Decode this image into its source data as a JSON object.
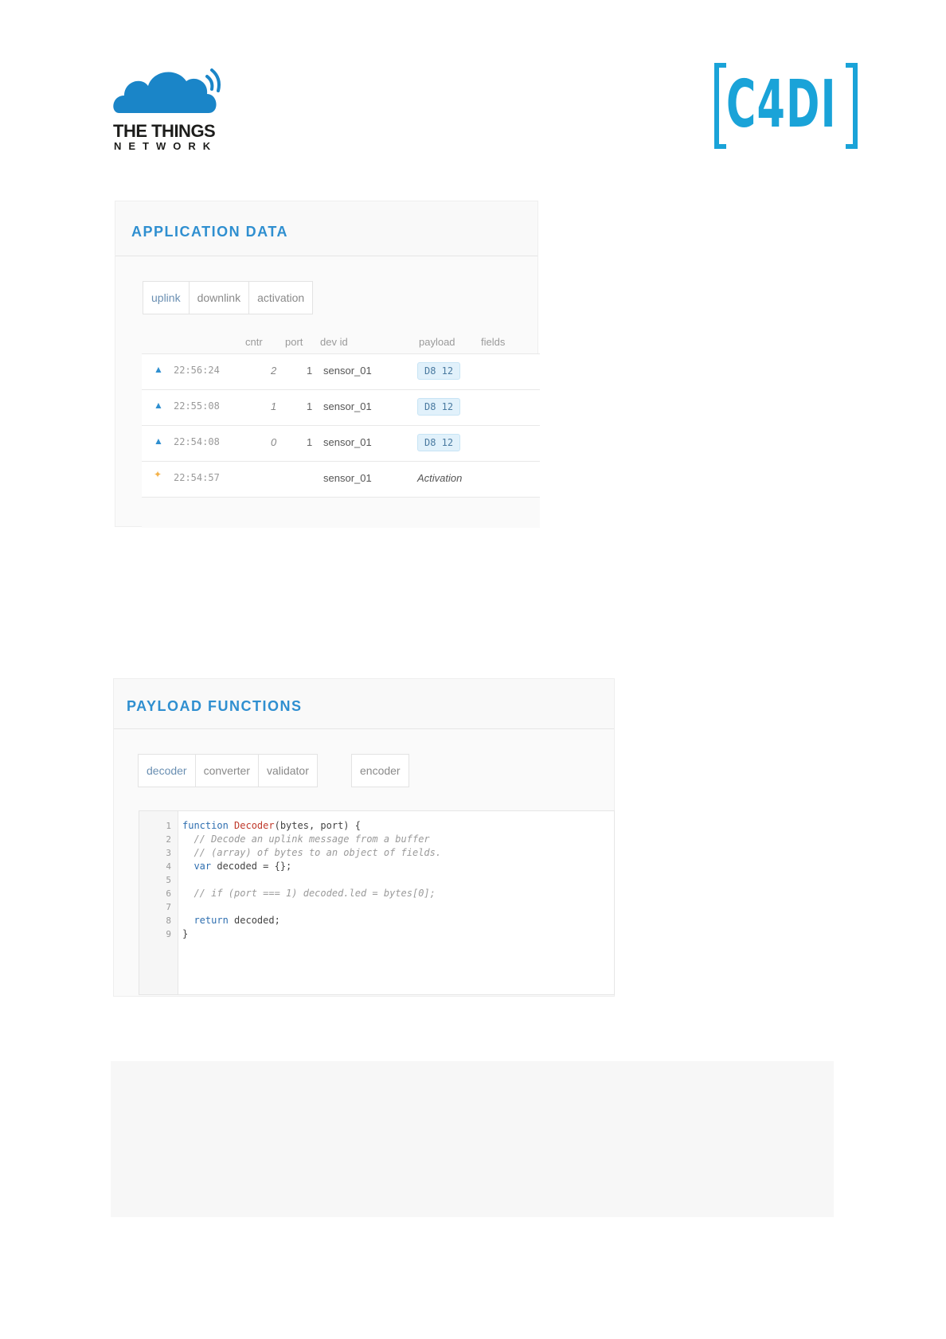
{
  "logos": {
    "ttn_title": "THE THINGS",
    "ttn_subtitle": "NETWORK",
    "c4di": "C4DI"
  },
  "colors": {
    "accent": "#2f8fd0",
    "c4di_blue": "#1aa3d8",
    "activation": "#f4b24a",
    "badge_bg": "#e1f1fb"
  },
  "application_data": {
    "title": "APPLICATION DATA",
    "tabs": [
      "uplink",
      "downlink",
      "activation"
    ],
    "columns": {
      "cntr": "cntr",
      "port": "port",
      "devid": "dev id",
      "payload": "payload",
      "fields": "fields"
    },
    "rows": [
      {
        "icon": "uplink-arrow-icon",
        "time": "22:56:24",
        "cntr": "2",
        "port": "1",
        "devid": "sensor_01",
        "payload": "D8 12"
      },
      {
        "icon": "uplink-arrow-icon",
        "time": "22:55:08",
        "cntr": "1",
        "port": "1",
        "devid": "sensor_01",
        "payload": "D8 12"
      },
      {
        "icon": "uplink-arrow-icon",
        "time": "22:54:08",
        "cntr": "0",
        "port": "1",
        "devid": "sensor_01",
        "payload": "D8 12"
      },
      {
        "icon": "activation-bolt-icon",
        "time": "22:54:57",
        "cntr": "",
        "port": "",
        "devid": "sensor_01",
        "payload": "Activation"
      }
    ]
  },
  "payload_functions": {
    "title": "PAYLOAD FUNCTIONS",
    "tabs": [
      "decoder",
      "converter",
      "validator"
    ],
    "tab_encoder": "encoder",
    "code": {
      "line_numbers": [
        "1",
        "2",
        "3",
        "4",
        "5",
        "6",
        "7",
        "8",
        "9"
      ],
      "l1_kw": "function",
      "l1_fn": "Decoder",
      "l1_rest": "(bytes, port) {",
      "l2": "  // Decode an uplink message from a buffer",
      "l3": "  // (array) of bytes to an object of fields.",
      "l4_kw": "  var",
      "l4_rest": " decoded = {};",
      "l6": "  // if (port === 1) decoded.led = bytes[0];",
      "l8_kw": "  return",
      "l8_rest": " decoded;",
      "l9": "}"
    }
  }
}
